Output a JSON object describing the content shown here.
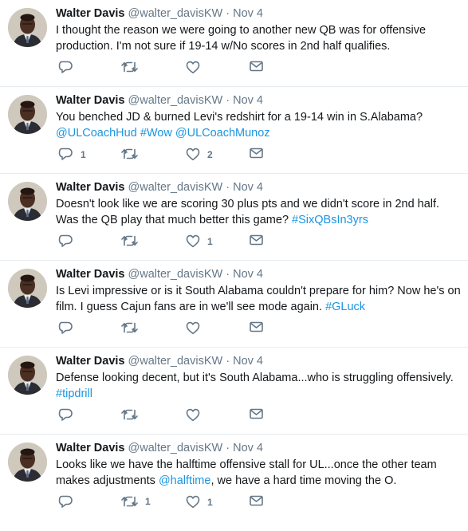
{
  "colors": {
    "link": "#1b95e0",
    "muted": "#657786",
    "text": "#14171a",
    "divider": "#e6ecf0"
  },
  "icons": {
    "reply": "reply-icon",
    "retweet": "retweet-icon",
    "like": "heart-icon",
    "dm": "envelope-icon"
  },
  "tweets": [
    {
      "name": "Walter Davis",
      "handle": "@walter_davisKW",
      "dot": "·",
      "time": "Nov 4",
      "segments": [
        {
          "t": "I thought the reason we were going to another new QB was for offensive production. I'm not sure if 19-14 w/No scores in 2nd half qualifies.",
          "link": false
        }
      ],
      "replies": "",
      "retweets": "",
      "likes": ""
    },
    {
      "name": "Walter Davis",
      "handle": "@walter_davisKW",
      "dot": "·",
      "time": "Nov 4",
      "segments": [
        {
          "t": "You benched JD & burned Levi's redshirt for a 19-14 win in S.Alabama? ",
          "link": false
        },
        {
          "t": "@ULCoachHud",
          "link": true
        },
        {
          "t": " ",
          "link": false
        },
        {
          "t": "#Wow",
          "link": true
        },
        {
          "t": " ",
          "link": false
        },
        {
          "t": "@ULCoachMunoz",
          "link": true
        }
      ],
      "replies": "1",
      "retweets": "",
      "likes": "2"
    },
    {
      "name": "Walter Davis",
      "handle": "@walter_davisKW",
      "dot": "·",
      "time": "Nov 4",
      "segments": [
        {
          "t": "Doesn't look like we are scoring 30 plus pts and we didn't score in 2nd half. Was the QB play that much better this game? ",
          "link": false
        },
        {
          "t": "#SixQBsIn3yrs",
          "link": true
        }
      ],
      "replies": "",
      "retweets": "",
      "likes": "1"
    },
    {
      "name": "Walter Davis",
      "handle": "@walter_davisKW",
      "dot": "·",
      "time": "Nov 4",
      "segments": [
        {
          "t": "Is Levi impressive or is it South Alabama couldn't prepare for him? Now he's on film. I guess Cajun fans are in we'll see mode again. ",
          "link": false
        },
        {
          "t": "#GLuck",
          "link": true
        }
      ],
      "replies": "",
      "retweets": "",
      "likes": ""
    },
    {
      "name": "Walter Davis",
      "handle": "@walter_davisKW",
      "dot": "·",
      "time": "Nov 4",
      "segments": [
        {
          "t": "Defense looking decent, but it's South Alabama...who is struggling offensively. ",
          "link": false
        },
        {
          "t": "#tipdrill",
          "link": true
        }
      ],
      "replies": "",
      "retweets": "",
      "likes": ""
    },
    {
      "name": "Walter Davis",
      "handle": "@walter_davisKW",
      "dot": "·",
      "time": "Nov 4",
      "segments": [
        {
          "t": "Looks like we have the halftime offensive stall for UL...once the other team makes adjustments ",
          "link": false
        },
        {
          "t": "@halftime",
          "link": true
        },
        {
          "t": ", we have a hard time moving the O.",
          "link": false
        }
      ],
      "replies": "",
      "retweets": "1",
      "likes": "1"
    }
  ]
}
